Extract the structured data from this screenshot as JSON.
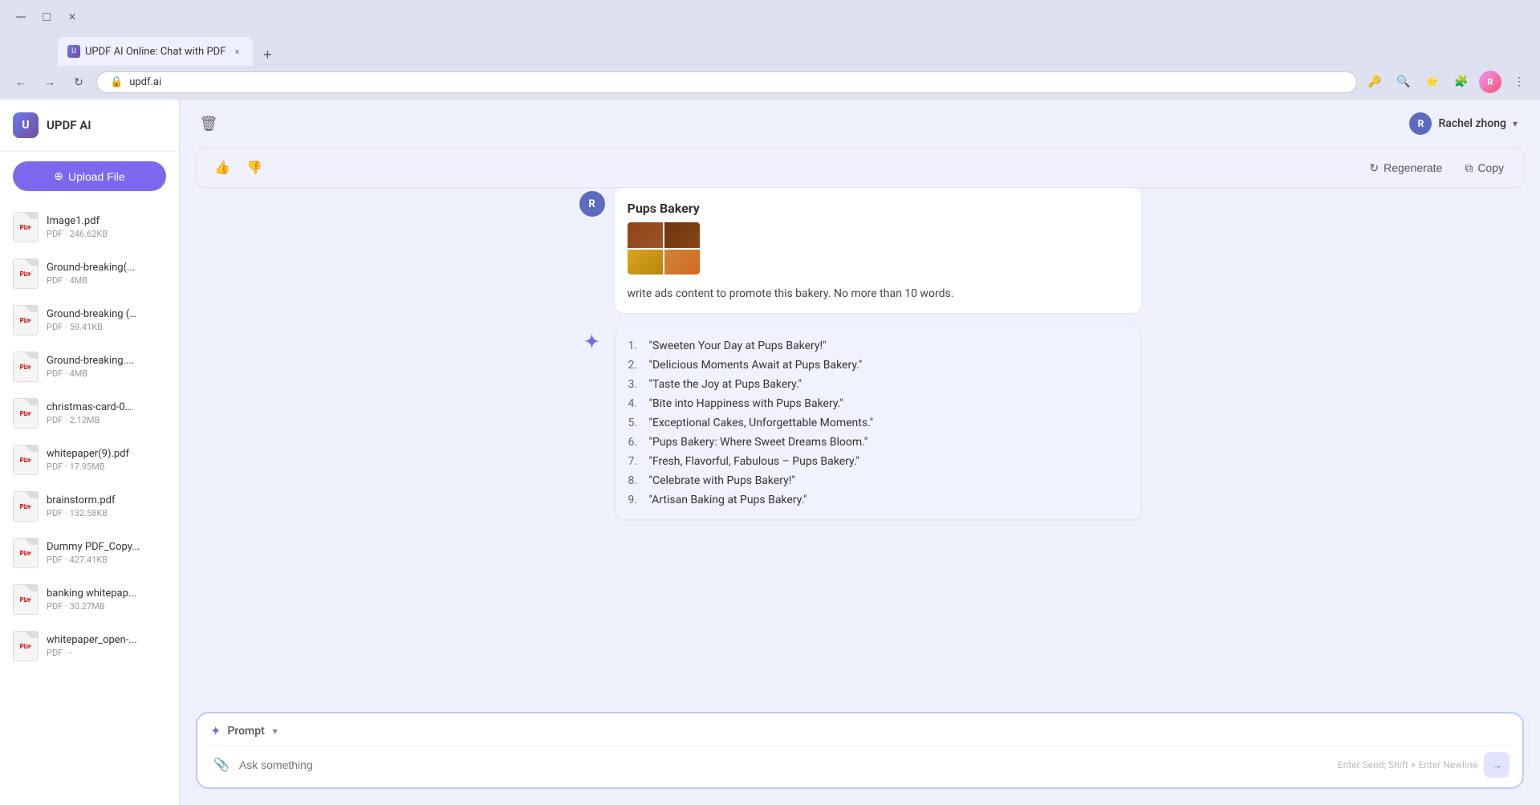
{
  "browser": {
    "tab_title": "UPDF AI Online: Chat with PDF",
    "tab_favicon": "U",
    "url": "updf.ai",
    "new_tab_label": "+",
    "close_label": "×",
    "profile_initials": "R"
  },
  "sidebar": {
    "title": "UPDF AI",
    "logo_label": "U",
    "upload_button_label": "Upload File",
    "files": [
      {
        "name": "Image1.pdf",
        "size": "PDF · 246.62KB"
      },
      {
        "name": "Ground-breaking(...",
        "size": "PDF · 4MB"
      },
      {
        "name": "Ground-breaking (…",
        "size": "PDF · 59.41KB"
      },
      {
        "name": "Ground-breaking....",
        "size": "PDF · 4MB"
      },
      {
        "name": "christmas-card-0…",
        "size": "PDF · 2.12MB"
      },
      {
        "name": "whitepaper(9).pdf",
        "size": "PDF · 17.95MB"
      },
      {
        "name": "brainstorm.pdf",
        "size": "PDF · 132.58KB"
      },
      {
        "name": "Dummy PDF_Copy...",
        "size": "PDF · 427.41KB"
      },
      {
        "name": "banking whitepap...",
        "size": "PDF · 30.27MB"
      },
      {
        "name": "whitepaper_open-...",
        "size": "PDF · -"
      }
    ]
  },
  "toolbar": {
    "trash_icon": "🗑",
    "thumbs_up_icon": "👍",
    "thumbs_down_icon": "👎",
    "regenerate_label": "Regenerate",
    "copy_label": "Copy"
  },
  "user": {
    "name": "Rachel zhong",
    "avatar_initials": "R",
    "chevron": "▾"
  },
  "messages": {
    "user_avatar_initials": "R",
    "ai_avatar": "✦",
    "bakery": {
      "name": "Pups Bakery",
      "prompt": "write ads content to promote this bakery. No more than 10 words."
    },
    "ai_responses": [
      {
        "number": "1.",
        "text": "\"Sweeten Your Day at Pups Bakery!\""
      },
      {
        "number": "2.",
        "text": "\"Delicious Moments Await at Pups Bakery.\""
      },
      {
        "number": "3.",
        "text": "\"Taste the Joy at Pups Bakery.\""
      },
      {
        "number": "4.",
        "text": "\"Bite into Happiness with Pups Bakery.\""
      },
      {
        "number": "5.",
        "text": "\"Exceptional Cakes, Unforgettable Moments.\""
      },
      {
        "number": "6.",
        "text": "\"Pups Bakery: Where Sweet Dreams Bloom.\""
      },
      {
        "number": "7.",
        "text": "\"Fresh, Flavorful, Fabulous – Pups Bakery.\""
      },
      {
        "number": "8.",
        "text": "\"Celebrate with Pups Bakery!\""
      },
      {
        "number": "9.",
        "text": "\"Artisan Baking at Pups Bakery.\""
      }
    ]
  },
  "input": {
    "sparkle": "✦",
    "prompt_label": "Prompt",
    "dropdown_arrow": "▾",
    "placeholder": "Ask something",
    "hint": "Enter Send; Shift + Enter Newline",
    "send_icon": "→"
  }
}
